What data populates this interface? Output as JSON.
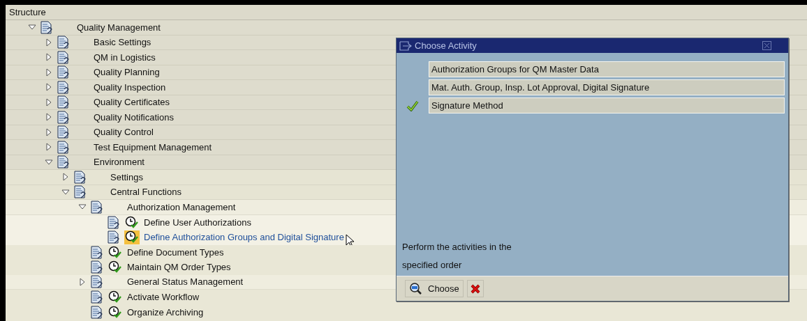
{
  "structure": {
    "header": "Structure",
    "tree": [
      {
        "label": "Quality Management",
        "expanded": true,
        "activity": false,
        "selected": false,
        "children": [
          {
            "label": "Basic Settings",
            "expanded": false,
            "activity": false,
            "selected": false
          },
          {
            "label": "QM in Logistics",
            "expanded": false,
            "activity": false,
            "selected": false
          },
          {
            "label": "Quality Planning",
            "expanded": false,
            "activity": false,
            "selected": false
          },
          {
            "label": "Quality Inspection",
            "expanded": false,
            "activity": false,
            "selected": false
          },
          {
            "label": "Quality Certificates",
            "expanded": false,
            "activity": false,
            "selected": false
          },
          {
            "label": "Quality Notifications",
            "expanded": false,
            "activity": false,
            "selected": false
          },
          {
            "label": "Quality Control",
            "expanded": false,
            "activity": false,
            "selected": false
          },
          {
            "label": "Test Equipment Management",
            "expanded": false,
            "activity": false,
            "selected": false
          },
          {
            "label": "Environment",
            "expanded": true,
            "activity": false,
            "selected": false,
            "children": [
              {
                "label": "Settings",
                "expanded": false,
                "activity": false,
                "selected": false
              },
              {
                "label": "Central Functions",
                "expanded": true,
                "activity": false,
                "selected": false,
                "children": [
                  {
                    "label": "Authorization Management",
                    "expanded": true,
                    "activity": false,
                    "selected": false,
                    "children": [
                      {
                        "label": "Define User Authorizations",
                        "activity": true,
                        "selected": false
                      },
                      {
                        "label": "Define Authorization Groups and Digital Signature",
                        "activity": true,
                        "selected": true
                      }
                    ]
                  },
                  {
                    "label": "Define Document Types",
                    "activity": true,
                    "selected": false
                  },
                  {
                    "label": "Maintain QM Order Types",
                    "activity": true,
                    "selected": false
                  },
                  {
                    "label": "General Status Management",
                    "expanded": false,
                    "activity": false,
                    "selected": false
                  },
                  {
                    "label": "Activate Workflow",
                    "activity": true,
                    "selected": false
                  },
                  {
                    "label": "Organize Archiving",
                    "activity": true,
                    "selected": false
                  }
                ]
              }
            ]
          }
        ]
      }
    ]
  },
  "dialog": {
    "title": "Choose Activity",
    "activities": [
      {
        "label": "Authorization Groups for QM Master Data",
        "checked": false
      },
      {
        "label": "Mat. Auth. Group, Insp. Lot Approval, Digital Signature",
        "checked": false
      },
      {
        "label": "Signature Method",
        "checked": true
      }
    ],
    "note_lines": [
      "Perform the activities in the",
      "specified order"
    ],
    "choose_button": "Choose"
  }
}
